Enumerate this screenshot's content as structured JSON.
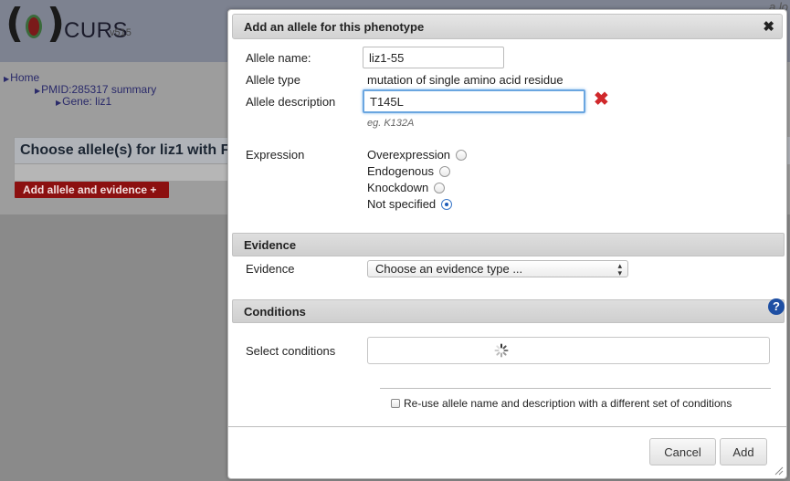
{
  "app": {
    "logo_open": "(",
    "logo_close": ")",
    "name": "CURS",
    "version": "v515",
    "user_fragment": "a.lo"
  },
  "breadcrumb": {
    "home": "Home",
    "pmid": "PMID:285317 summary",
    "gene": "Gene: liz1"
  },
  "background": {
    "choose_title": "Choose allele(s) for liz1 with F",
    "add_button": "Add allele and evidence +"
  },
  "dialog": {
    "title": "Add an allele for this phenotype",
    "close": "✖",
    "allele_name_label": "Allele name:",
    "allele_name_value": "liz1-55",
    "allele_type_label": "Allele type",
    "allele_type_value": "mutation of single amino acid residue",
    "allele_description_label": "Allele description",
    "allele_description_value": "T145L",
    "description_clear": "✖",
    "description_hint": "eg. K132A",
    "expression_label": "Expression",
    "expression_options": [
      "Overexpression",
      "Endogenous",
      "Knockdown",
      "Not specified"
    ],
    "expression_selected": "Not specified",
    "evidence_section": "Evidence",
    "evidence_label": "Evidence",
    "evidence_select": "Choose an evidence type ...",
    "conditions_section": "Conditions",
    "conditions_help": "?",
    "select_conditions_label": "Select conditions",
    "reuse_label": "Re-use allele name and description with a different set of conditions",
    "reuse_checked": false,
    "cancel_label": "Cancel",
    "add_label": "Add"
  },
  "colors": {
    "accent_red": "#8c1010",
    "clear_red": "#d0282b",
    "focus_blue": "#6aa6e0",
    "help_blue": "#1e4fa3"
  }
}
